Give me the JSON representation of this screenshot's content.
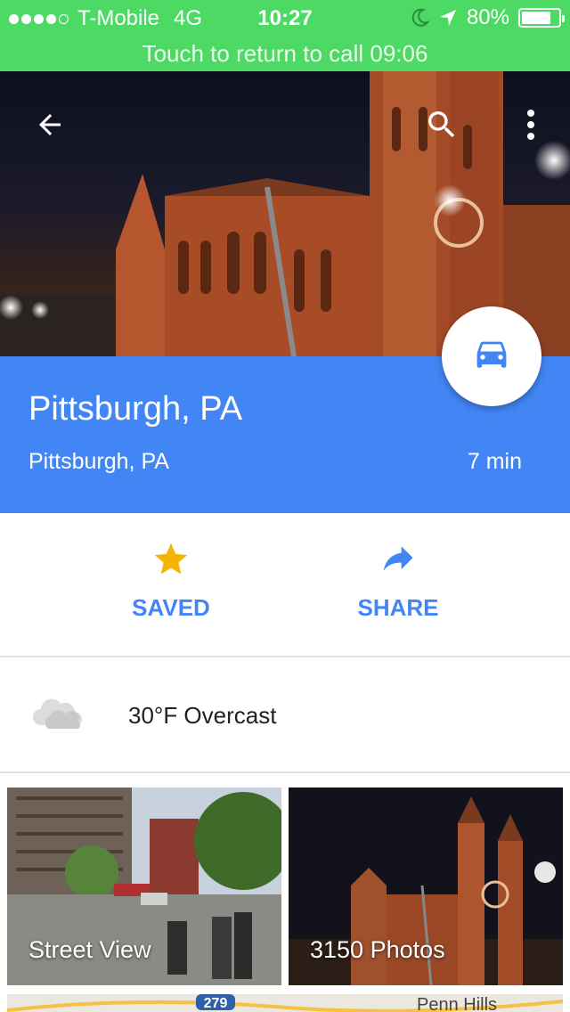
{
  "status_bar": {
    "carrier": "T-Mobile",
    "network": "4G",
    "time": "10:27",
    "battery": "80%",
    "battery_level": 0.8
  },
  "call_banner": {
    "text": "Touch to return to call  09:06"
  },
  "toolbar": {
    "back_icon": "arrow-back-icon",
    "search_icon": "search-icon",
    "more_icon": "more-vert-icon"
  },
  "place": {
    "title": "Pittsburgh, PA",
    "subtitle": "Pittsburgh, PA",
    "eta": "7 min",
    "directions_icon": "car-icon"
  },
  "actions": [
    {
      "label": "SAVED",
      "icon": "star-icon",
      "color": "#f4b400"
    },
    {
      "label": "SHARE",
      "icon": "share-arrow-icon",
      "color": "#4285f4"
    }
  ],
  "weather": {
    "text": "30°F Overcast",
    "icon": "cloud-icon"
  },
  "tiles": [
    {
      "label": "Street View"
    },
    {
      "label": "3150 Photos"
    }
  ],
  "map_preview": {
    "route_label": "279",
    "place_label": "Penn Hills"
  },
  "colors": {
    "status_green": "#4cd964",
    "brand_blue": "#4285f4",
    "star_yellow": "#f4b400"
  }
}
